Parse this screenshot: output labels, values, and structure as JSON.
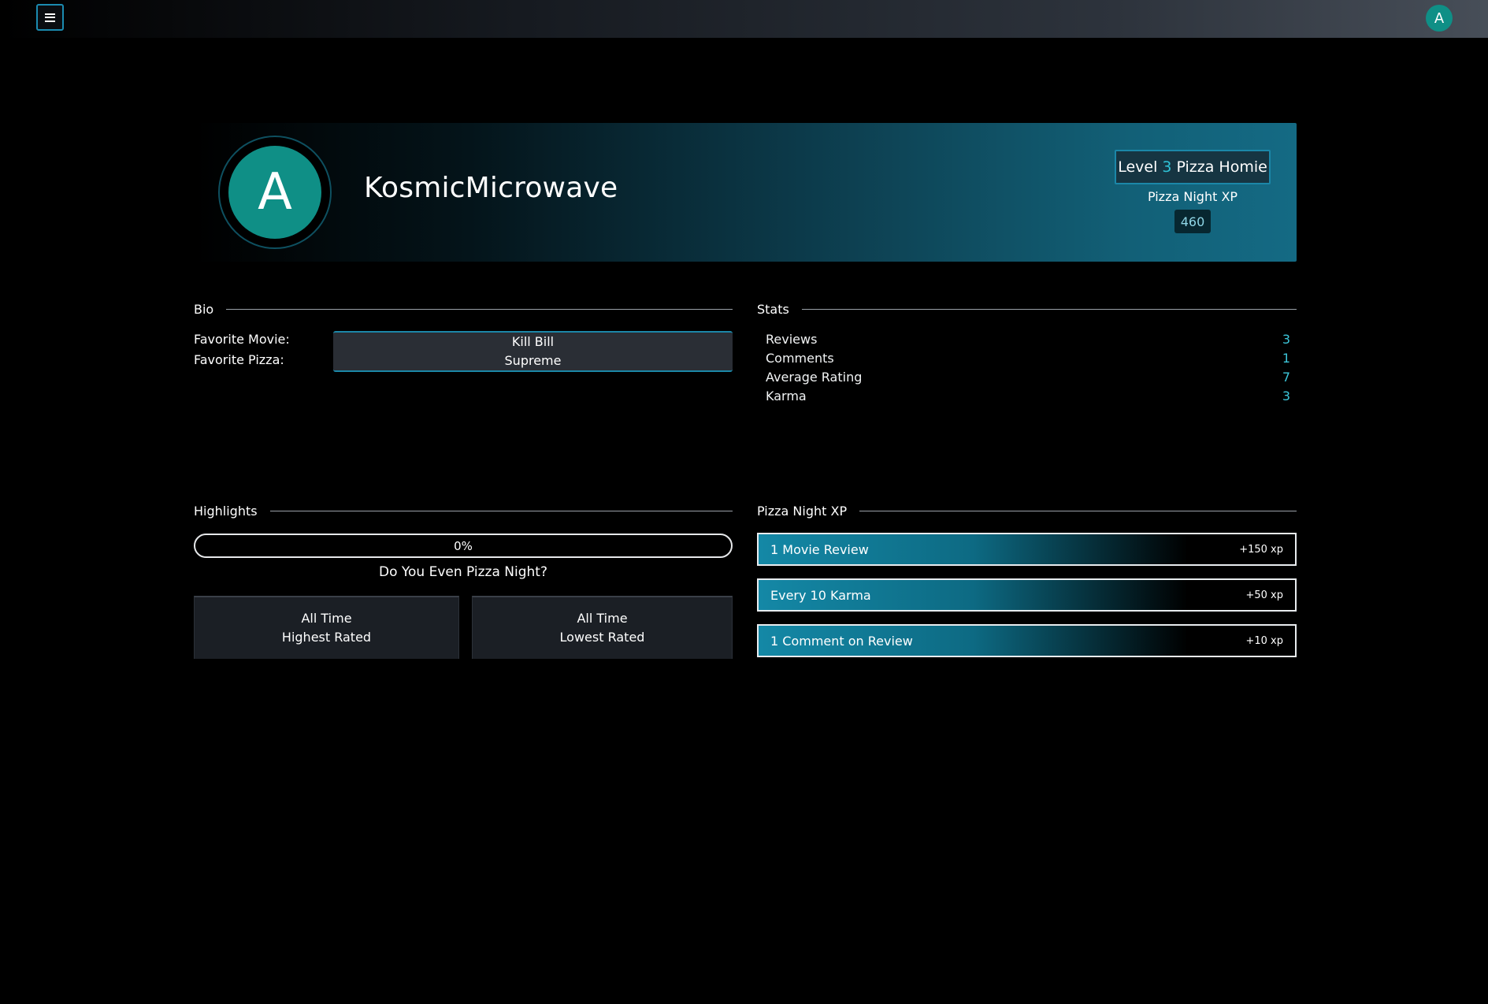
{
  "topbar": {
    "menu_icon": "hamburger-icon",
    "avatar_letter": "A"
  },
  "profile": {
    "avatar_letter": "A",
    "username": "KosmicMicrowave",
    "level_prefix": "Level",
    "level_number": "3",
    "level_title": "Pizza Homie",
    "xp_label": "Pizza Night XP",
    "xp_value": "460"
  },
  "bio": {
    "heading": "Bio",
    "movie_label": "Favorite Movie:",
    "pizza_label": "Favorite Pizza:",
    "movie_value": "Kill Bill",
    "pizza_value": "Supreme"
  },
  "stats": {
    "heading": "Stats",
    "rows": [
      {
        "label": "Reviews",
        "value": "3"
      },
      {
        "label": "Comments",
        "value": "1"
      },
      {
        "label": "Average Rating",
        "value": "7"
      },
      {
        "label": "Karma",
        "value": "3"
      }
    ]
  },
  "highlights": {
    "heading": "Highlights",
    "progress_text": "0%",
    "progress_fraction": 0,
    "caption": "Do You Even Pizza Night?",
    "cards": [
      {
        "line1": "All Time",
        "line2": "Highest Rated"
      },
      {
        "line1": "All Time",
        "line2": "Lowest Rated"
      }
    ]
  },
  "xp_rules": {
    "heading": "Pizza Night XP",
    "rows": [
      {
        "name": "1 Movie Review",
        "points": "+150 xp"
      },
      {
        "name": "Every 10 Karma",
        "points": "+50 xp"
      },
      {
        "name": "1 Comment on Review",
        "points": "+10 xp"
      }
    ]
  },
  "colors": {
    "accent": "#1b87a8",
    "avatar": "#0f8f86",
    "stat_value": "#3cc6da"
  }
}
